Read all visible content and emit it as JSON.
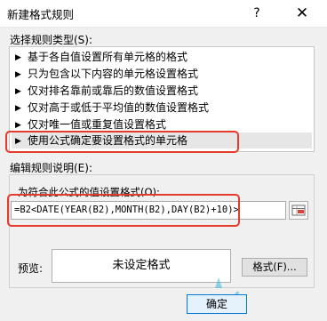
{
  "window": {
    "title": "新建格式规则",
    "help_label": "?",
    "close_label": "✕"
  },
  "rule_type": {
    "label": "选择规则类型(S):",
    "items": [
      {
        "label": "基于各自值设置所有单元格的格式"
      },
      {
        "label": "只为包含以下内容的单元格设置格式"
      },
      {
        "label": "仅对排名靠前或靠后的数值设置格式"
      },
      {
        "label": "仅对高于或低于平均值的数值设置格式"
      },
      {
        "label": "仅对唯一值或重复值设置格式"
      },
      {
        "label": "使用公式确定要设置格式的单元格"
      }
    ],
    "selected_index": 5,
    "arrow_glyph": "▶"
  },
  "description": {
    "label": "编辑规则说明(E):",
    "formula_label": "为符合此公式的值设置格式(O):",
    "formula_value": "=B2<DATE(YEAR(B2),MONTH(B2),DAY(B2)+10)>",
    "preview_label": "预览:",
    "preview_text": "未设定格式",
    "format_button": "格式(F)..."
  },
  "footer": {
    "ok_button": "确定"
  },
  "colors": {
    "annotation_red": "#e53a2c",
    "selection_gray": "#e6e6e6"
  }
}
